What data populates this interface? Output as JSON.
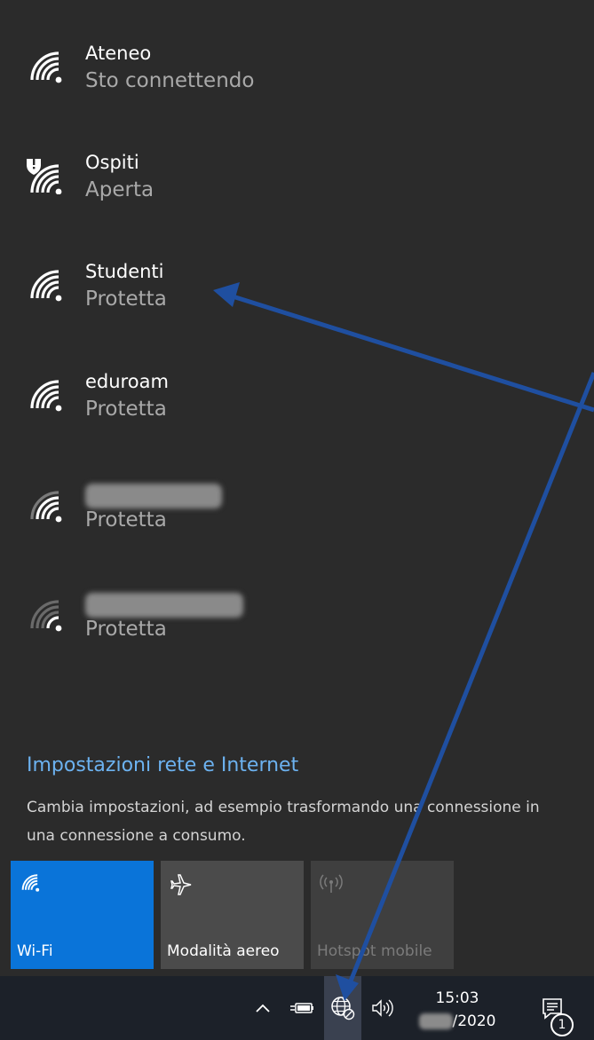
{
  "networks": [
    {
      "name": "Ateneo",
      "status": "Sto connettendo",
      "strength": "full"
    },
    {
      "name": "Ospiti",
      "status": "Aperta",
      "strength": "full",
      "secured": false,
      "warning": true
    },
    {
      "name": "Studenti",
      "status": "Protetta",
      "strength": "full"
    },
    {
      "name": "eduroam",
      "status": "Protetta",
      "strength": "full"
    },
    {
      "name": "",
      "status": "Protetta",
      "strength": "medium",
      "name_redacted": true
    },
    {
      "name": "",
      "status": "Protetta",
      "strength": "low",
      "name_redacted": true
    }
  ],
  "settings": {
    "title": "Impostazioni rete e Internet",
    "description": "Cambia impostazioni, ad esempio trasformando una connessione in una connessione a consumo."
  },
  "quick_actions": [
    {
      "label": "Wi-Fi",
      "state": "on",
      "icon": "wifi-icon"
    },
    {
      "label": "Modalità aereo",
      "state": "off",
      "icon": "airplane-icon"
    },
    {
      "label": "Hotspot mobile",
      "state": "disabled",
      "icon": "hotspot-icon"
    }
  ],
  "taskbar": {
    "time": "15:03",
    "date_visible": "/2020",
    "notification_count": "1"
  },
  "colors": {
    "panel_bg": "#2b2b2b",
    "accent": "#0a74d9",
    "link": "#6cb2f0",
    "annotation_arrow": "#1f4fa0"
  }
}
